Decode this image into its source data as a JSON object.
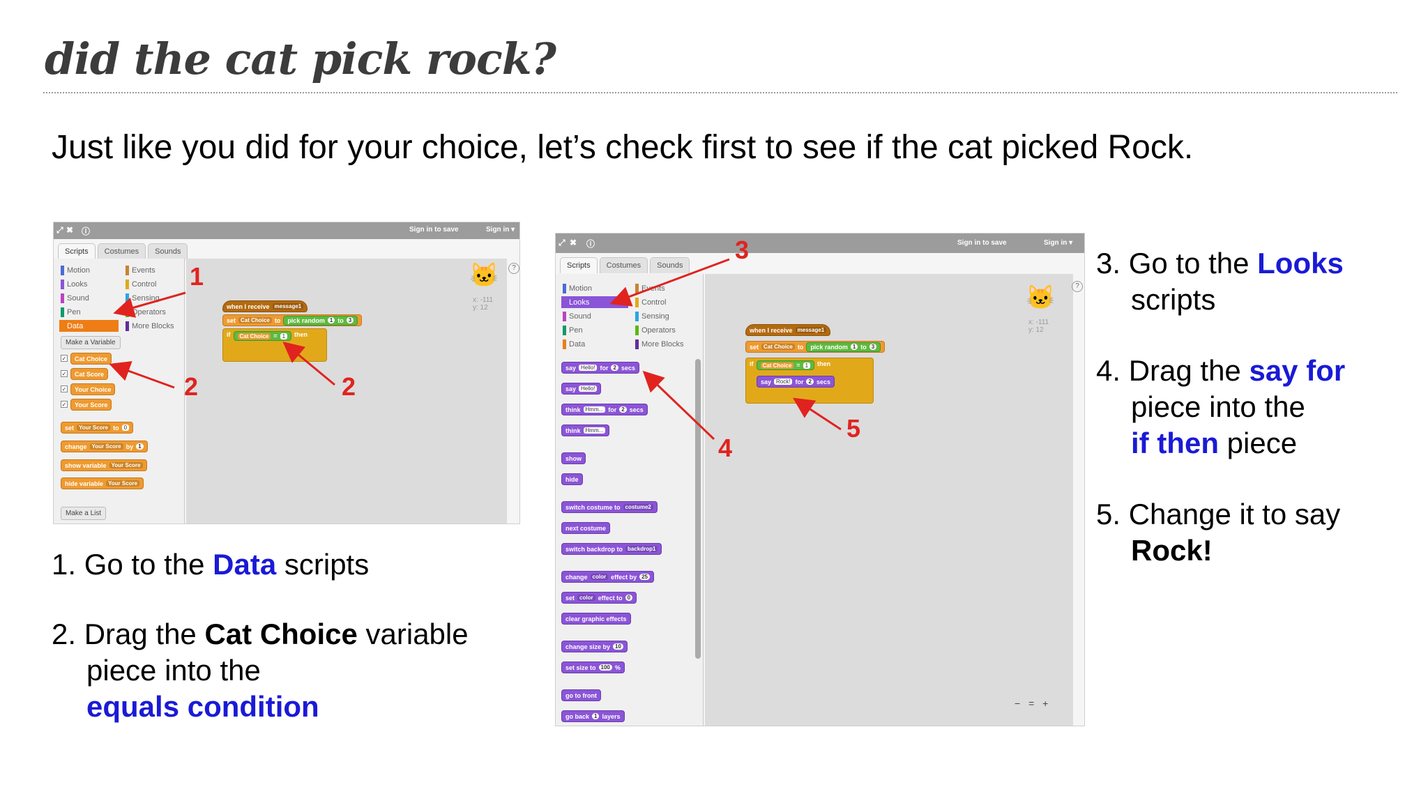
{
  "slide": {
    "title": "did the cat pick rock?",
    "subtitle": "Just like you did for your choice, let’s check first to see if the cat picked Rock."
  },
  "colors": {
    "accent_blue": "#1a1ad6",
    "annotation_red": "#e0231f",
    "data_orange": "#ee9a30",
    "looks_purple": "#8b55d6",
    "operators_green": "#5fb941"
  },
  "editor": {
    "sign_in_to_save": "Sign in to save",
    "sign_in": "Sign in ▾",
    "tabs": [
      "Scripts",
      "Costumes",
      "Sounds"
    ],
    "categories": [
      "Motion",
      "Events",
      "Looks",
      "Control",
      "Sound",
      "Sensing",
      "Pen",
      "Operators",
      "Data",
      "More Blocks"
    ],
    "coords": "x: -111\ny: 12",
    "icons": [
      "fullscreen-icon",
      "collapse-icon",
      "help-icon",
      "cat-sprite-icon",
      "zoom-out-icon",
      "zoom-reset-icon",
      "zoom-in-icon"
    ]
  },
  "shot1": {
    "make_variable": "Make a Variable",
    "variables": [
      "Cat Choice",
      "Cat Score",
      "Your Choice",
      "Your Score"
    ],
    "set_block": {
      "op": "set",
      "var": "Your Score",
      "to": "to",
      "val": "0"
    },
    "change_block": {
      "op": "change",
      "var": "Your Score",
      "by": "by",
      "val": "1"
    },
    "show_block": {
      "op": "show variable",
      "var": "Your Score"
    },
    "hide_block": {
      "op": "hide variable",
      "var": "Your Score"
    },
    "make_list": "Make a List",
    "script": {
      "when_receive": "when I receive",
      "message": "message1",
      "set": "set",
      "var": "Cat Choice",
      "to": "to",
      "pick_random": "pick random",
      "from": "1",
      "to2": "to",
      "max": "3",
      "if": "if",
      "cond_var": "Cat Choice",
      "eq": "=",
      "cond_val": "1",
      "then": "then"
    },
    "markers": [
      "1",
      "2",
      "2"
    ]
  },
  "shot2": {
    "palette": {
      "say_for": {
        "say": "say",
        "text": "Hello!",
        "for": "for",
        "n": "2",
        "secs": "secs"
      },
      "say": {
        "say": "say",
        "text": "Hello!"
      },
      "think_for": {
        "think": "think",
        "text": "Hmm...",
        "for": "for",
        "n": "2",
        "secs": "secs"
      },
      "think": {
        "think": "think",
        "text": "Hmm..."
      },
      "show": "show",
      "hide": "hide",
      "switch_costume": {
        "label": "switch costume to",
        "val": "costume2"
      },
      "next_costume": "next costume",
      "switch_backdrop": {
        "label": "switch backdrop to",
        "val": "backdrop1"
      },
      "change_effect": {
        "change": "change",
        "effect": "color",
        "label": "effect by",
        "val": "25"
      },
      "set_effect": {
        "set": "set",
        "effect": "color",
        "label": "effect to",
        "val": "0"
      },
      "clear_effects": "clear graphic effects",
      "change_size": {
        "label": "change size by",
        "val": "10"
      },
      "set_size": {
        "label": "set size to",
        "val": "100",
        "pct": "%"
      },
      "go_front": "go to front",
      "go_back": {
        "go": "go back",
        "val": "1",
        "layers": "layers"
      }
    },
    "script": {
      "when_receive": "when I receive",
      "message": "message1",
      "set": "set",
      "var": "Cat Choice",
      "to": "to",
      "pick_random": "pick random",
      "from": "1",
      "to2": "to",
      "max": "3",
      "if": "if",
      "cond_var": "Cat Choice",
      "eq": "=",
      "cond_val": "1",
      "then": "then",
      "say": "say",
      "say_text": "Rock!",
      "for": "for",
      "n": "2",
      "secs": "secs"
    },
    "zoom": "− = +",
    "markers": [
      "3",
      "4",
      "5"
    ]
  },
  "steps": {
    "s1": {
      "num": "1.",
      "pre": "Go to the",
      "key": "Data",
      "post": "scripts"
    },
    "s2": {
      "num": "2.",
      "pre": "Drag the",
      "key": "Cat Choice",
      "post": "variable",
      "line2": "piece into the",
      "line3": "equals condition"
    },
    "s3": {
      "num": "3.",
      "pre": "Go to the",
      "key": "Looks",
      "line2": "scripts"
    },
    "s4": {
      "num": "4.",
      "pre": "Drag the",
      "key": "say for",
      "line2": "piece into the",
      "key2": "if then",
      "post2": "piece"
    },
    "s5": {
      "num": "5.",
      "pre": "Change it to say",
      "key": "Rock!"
    }
  }
}
